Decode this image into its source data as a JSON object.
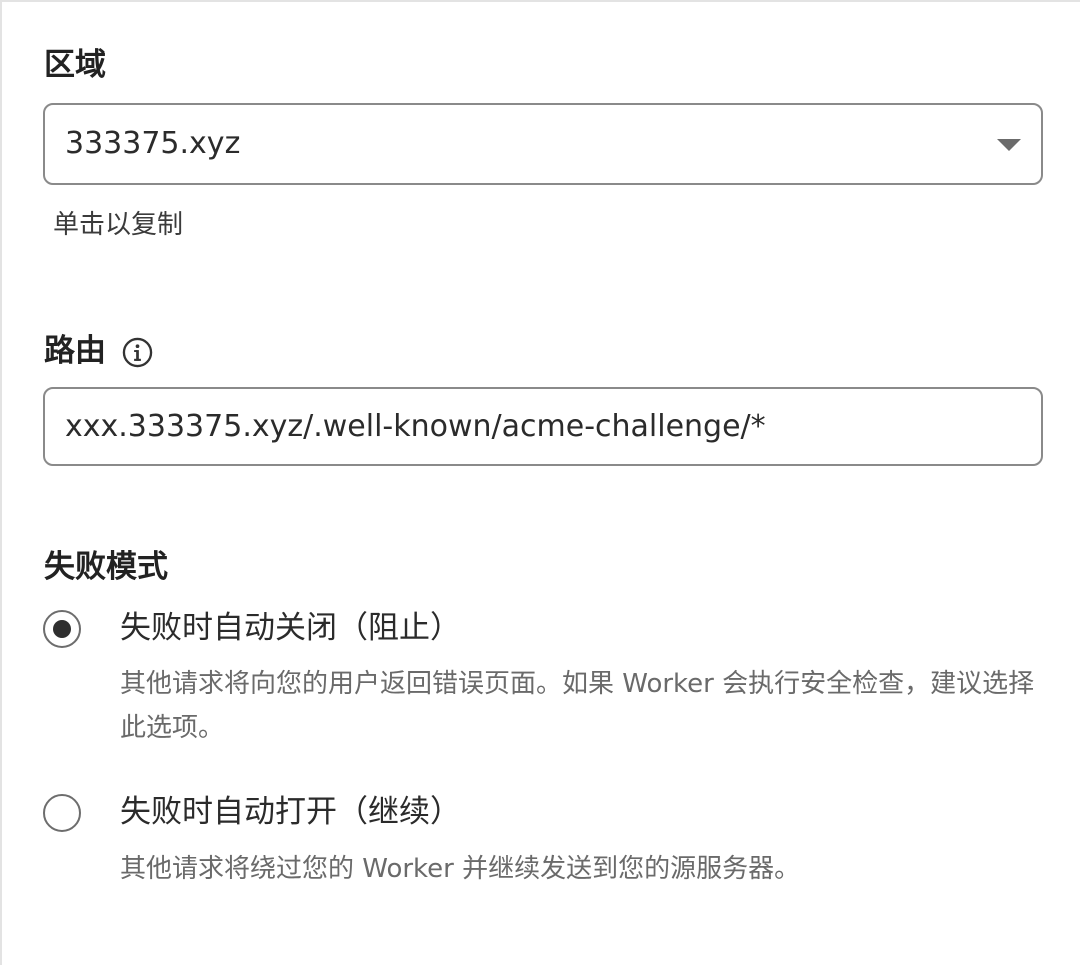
{
  "zone": {
    "label": "区域",
    "selected": "333375.xyz",
    "hint": "单击以复制"
  },
  "route": {
    "label": "路由",
    "value": "xxx.333375.xyz/.well-known/acme-challenge/*"
  },
  "failure_mode": {
    "label": "失败模式",
    "options": [
      {
        "label": "失败时自动关闭（阻止）",
        "description": "其他请求将向您的用户返回错误页面。如果 Worker 会执行安全检查，建议选择此选项。",
        "checked": true
      },
      {
        "label": "失败时自动打开（继续）",
        "description": "其他请求将绕过您的 Worker 并继续发送到您的源服务器。",
        "checked": false
      }
    ]
  }
}
